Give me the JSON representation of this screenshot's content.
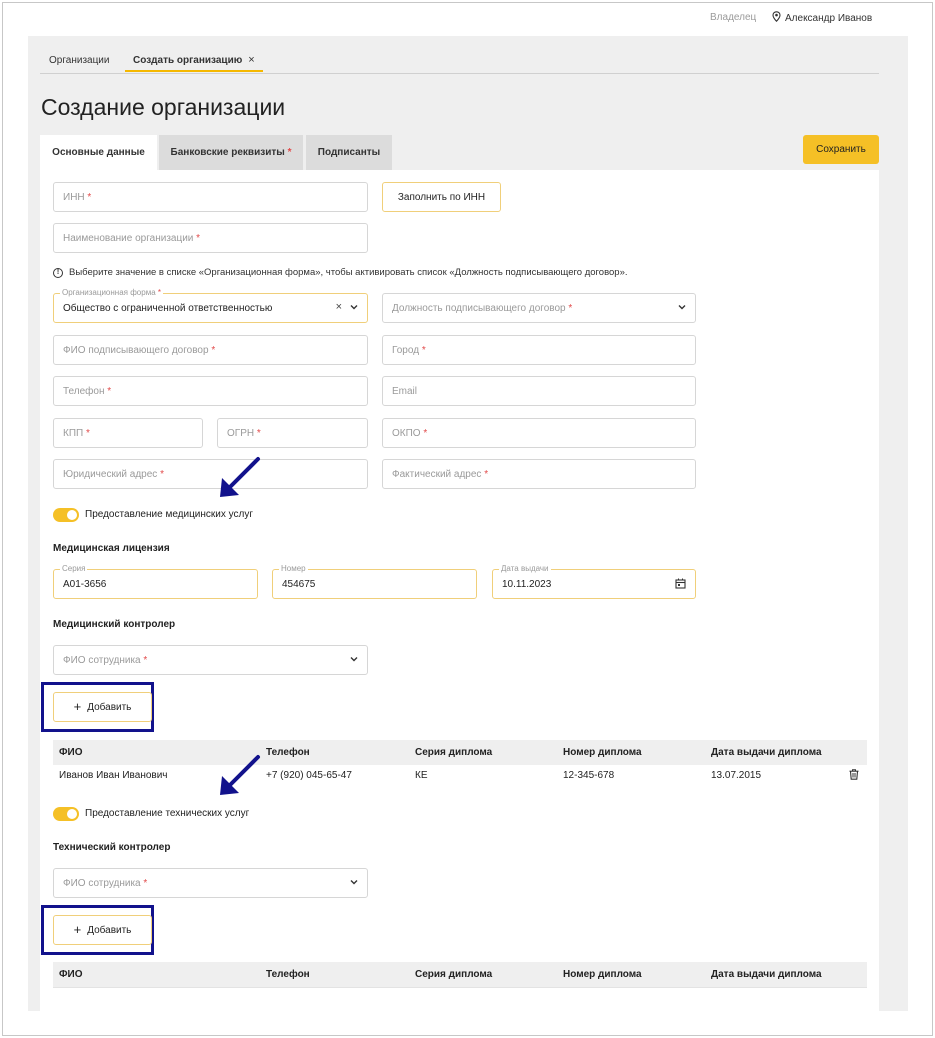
{
  "header": {
    "owner_label": "Владелец",
    "user_name": "Александр Иванов",
    "user_icon": "location-pin-icon"
  },
  "page_tabs": [
    {
      "label": "Организации"
    },
    {
      "label": "Создать организацию",
      "close": "×"
    }
  ],
  "title": "Создание организации",
  "form_tabs": [
    {
      "label": "Основные данные"
    },
    {
      "label": "Банковские реквизиты",
      "req": "*"
    },
    {
      "label": "Подписанты"
    }
  ],
  "save_label": "Сохранить",
  "fields": {
    "inn": "ИНН",
    "fill_by_inn": "Заполнить по ИНН",
    "org_name": "Наименование организации",
    "hint": "Выберите значение в списке «Организационная форма», чтобы активировать список «Должность подписывающего договор».",
    "org_form_label": "Организационная форма",
    "org_form_value": "Общество с ограниченной ответственностью",
    "signer_position": "Должность подписывающего договор",
    "signer_name": "ФИО подписывающего договор",
    "city": "Город",
    "phone": "Телефон",
    "email": "Email",
    "kpp": "КПП",
    "ogrn": "ОГРН",
    "okpo": "ОКПО",
    "legal_address": "Юридический адрес",
    "actual_address": "Фактический адрес",
    "req": "*"
  },
  "medical": {
    "toggle_label": "Предоставление медицинских услуг",
    "license_title": "Медицинская лицензия",
    "series_label": "Серия",
    "series_value": "А01-3656",
    "number_label": "Номер",
    "number_value": "454675",
    "date_label": "Дата выдачи",
    "date_value": "10.11.2023",
    "controller_title": "Медицинский контролер",
    "employee_placeholder": "ФИО сотрудника",
    "add_label": "Добавить"
  },
  "table_columns": [
    "ФИО",
    "Телефон",
    "Серия диплома",
    "Номер диплома",
    "Дата выдачи диплома"
  ],
  "medical_rows": [
    [
      "Иванов Иван Иванович",
      "+7 (920) 045-65-47",
      "КЕ",
      "12-345-678",
      "13.07.2015"
    ]
  ],
  "technical": {
    "toggle_label": "Предоставление технических услуг",
    "controller_title": "Технический контролер",
    "employee_placeholder": "ФИО сотрудника",
    "add_label": "Добавить"
  },
  "colors": {
    "accent": "#f5c026",
    "annotation": "#12128c"
  }
}
